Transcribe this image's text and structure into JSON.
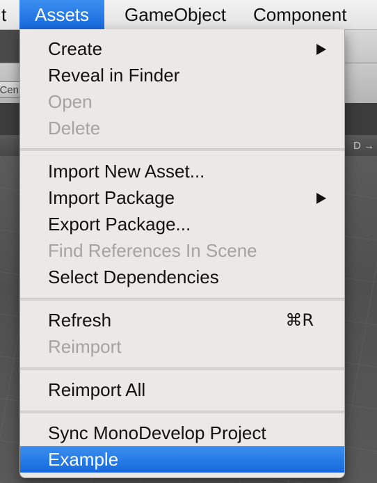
{
  "menubar": {
    "prev_item": "t",
    "assets": "Assets",
    "gameobject": "GameObject",
    "component": "Component"
  },
  "background": {
    "toolbar_button_text": "Cen",
    "tab_right_text": "D →"
  },
  "menu": {
    "create": "Create",
    "reveal_in_finder": "Reveal in Finder",
    "open": "Open",
    "delete": "Delete",
    "import_new_asset": "Import New Asset...",
    "import_package": "Import Package",
    "export_package": "Export Package...",
    "find_references": "Find References In Scene",
    "select_dependencies": "Select Dependencies",
    "refresh": "Refresh",
    "refresh_shortcut": "⌘R",
    "reimport": "Reimport",
    "reimport_all": "Reimport All",
    "sync_monodevelop": "Sync MonoDevelop Project",
    "example": "Example"
  },
  "colors": {
    "highlight": "#1a6fe0",
    "menu_bg": "#ebe9e8",
    "disabled_text": "#a5a3a2"
  }
}
